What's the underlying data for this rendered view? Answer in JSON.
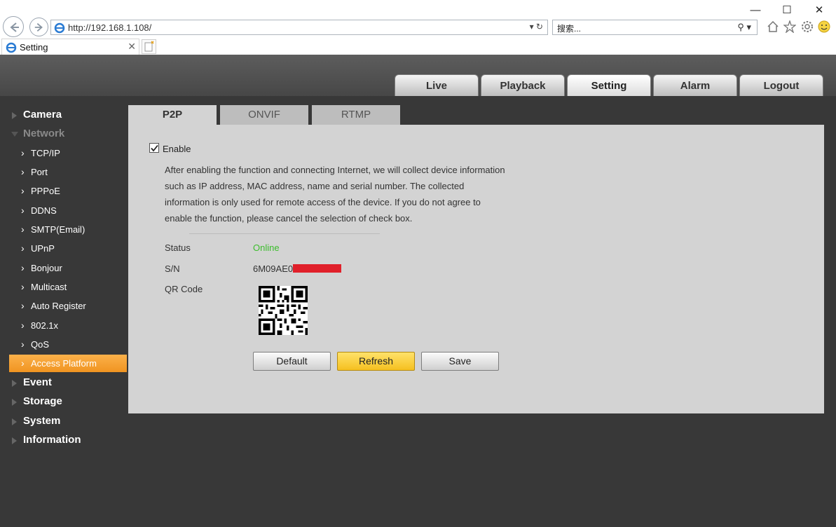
{
  "browser": {
    "url": "http://192.168.1.108/",
    "search_placeholder": "搜索...",
    "tab_title": "Setting"
  },
  "header": {
    "tabs": [
      {
        "label": "Live",
        "active": false
      },
      {
        "label": "Playback",
        "active": false
      },
      {
        "label": "Setting",
        "active": true
      },
      {
        "label": "Alarm",
        "active": false
      },
      {
        "label": "Logout",
        "active": false
      }
    ]
  },
  "sidebar": {
    "camera": "Camera",
    "network": "Network",
    "network_items": [
      "TCP/IP",
      "Port",
      "PPPoE",
      "DDNS",
      "SMTP(Email)",
      "UPnP",
      "Bonjour",
      "Multicast",
      "Auto Register",
      "802.1x",
      "QoS",
      "Access Platform"
    ],
    "active_item": "Access Platform",
    "event": "Event",
    "storage": "Storage",
    "system": "System",
    "information": "Information"
  },
  "subtabs": [
    {
      "label": "P2P",
      "active": true
    },
    {
      "label": "ONVIF",
      "active": false
    },
    {
      "label": "RTMP",
      "active": false
    }
  ],
  "p2p": {
    "enable_label": "Enable",
    "enabled": true,
    "description": [
      "After enabling the function and connecting Internet, we will collect device information",
      "such as IP address, MAC address, name and serial number. The collected",
      "information is only used for remote access of the device. If you do not agree to",
      "enable the function, please cancel the selection of check box."
    ],
    "status_label": "Status",
    "status_value": "Online",
    "sn_label": "S/N",
    "sn_value": "6M09AE0",
    "qr_label": "QR Code",
    "buttons": {
      "default": "Default",
      "refresh": "Refresh",
      "save": "Save"
    }
  },
  "colors": {
    "accent_orange": "#f5a030",
    "online_green": "#3cbd2c",
    "refresh_yellow": "#f9cf3a",
    "sidebar_bg": "#383838"
  }
}
